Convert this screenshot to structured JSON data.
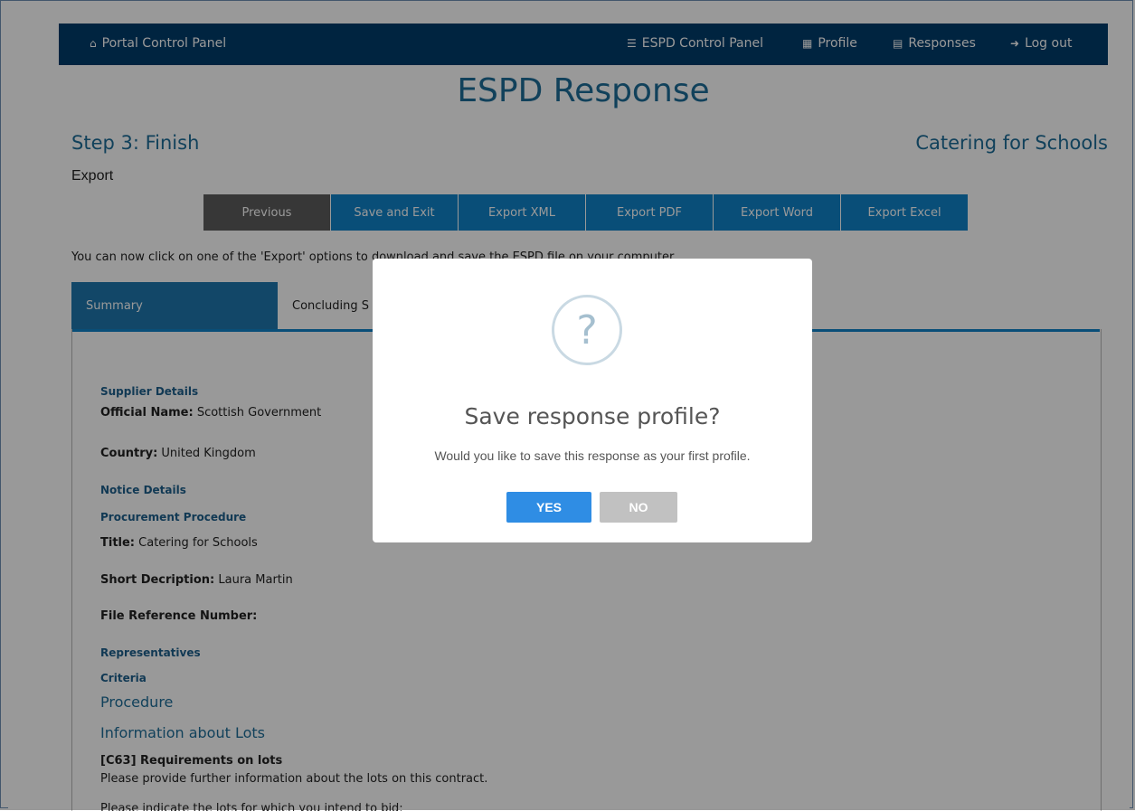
{
  "nav": {
    "portal": "Portal Control Panel",
    "espd": "ESPD Control Panel",
    "profile": "Profile",
    "responses": "Responses",
    "logout": "Log out"
  },
  "page_title": "ESPD Response",
  "step": "Step 3: Finish",
  "project": "Catering for Schools",
  "export_label": "Export",
  "buttons": {
    "previous": "Previous",
    "save_exit": "Save and Exit",
    "export_xml": "Export XML",
    "export_pdf": "Export PDF",
    "export_word": "Export Word",
    "export_excel": "Export Excel"
  },
  "instruction": "You can now click on one of the 'Export' options to download and save the ESPD file on your computer.",
  "tabs": {
    "summary": "Summary",
    "concluding": "Concluding S"
  },
  "summary": {
    "supplier_details": "Supplier Details",
    "official_name_label": "Official Name:",
    "official_name_value": "Scottish Government",
    "country_label": "Country:",
    "country_value": "United Kingdom",
    "notice_details": "Notice Details",
    "procurement_procedure": "Procurement Procedure",
    "title_label": "Title:",
    "title_value": "Catering for Schools",
    "short_desc_label": "Short Decription:",
    "short_desc_value": "Laura Martin",
    "file_ref_label": "File Reference Number:",
    "representatives": "Representatives",
    "criteria": "Criteria",
    "procedure": "Procedure",
    "info_lots": "Information about Lots",
    "c63": "[C63] Requirements on lots",
    "lots_info": "Please provide further information about the lots on this contract.",
    "lots_indicate": "Please indicate the lots for which you intend to bid:"
  },
  "modal": {
    "icon": "?",
    "title": "Save response profile?",
    "text": "Would you like to save this response as your first profile.",
    "yes": "YES",
    "no": "NO"
  }
}
